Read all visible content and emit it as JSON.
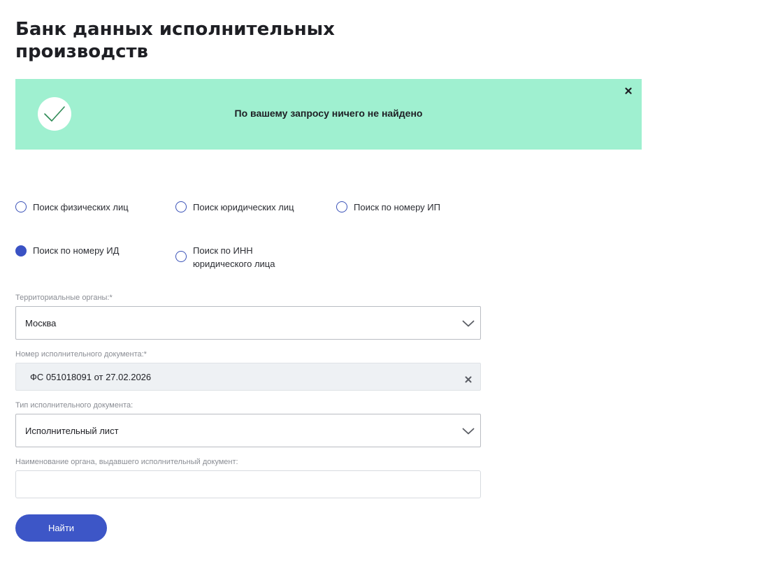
{
  "page": {
    "title": "Банк данных исполнительных производств"
  },
  "notification": {
    "message": "По вашему запросу ничего не найдено",
    "status_color": "#9ff0d0",
    "icon": "check-icon",
    "close_icon": "close-icon"
  },
  "search_types": {
    "selected": "Поиск по номеру ИД",
    "options": [
      {
        "label": "Поиск физических лиц",
        "checked": false
      },
      {
        "label": "Поиск юридических лиц",
        "checked": false
      },
      {
        "label": "Поиск по номеру ИП",
        "checked": false
      },
      {
        "label": "Поиск по номеру ИД",
        "checked": true
      },
      {
        "label": "Поиск по ИНН юридического лица",
        "checked": false
      }
    ]
  },
  "form": {
    "territorial_body": {
      "label": "Территориальные органы:*",
      "value": "Москва"
    },
    "document_number": {
      "label": "Номер исполнительного документа:*",
      "value": "ФС 051018091 от 27.02.2026"
    },
    "document_type": {
      "label": "Тип исполнительного документа:",
      "value": "Исполнительный лист"
    },
    "issuing_body": {
      "label": "Наименование органа, выдавшего исполнительный документ:",
      "value": ""
    },
    "submit_label": "Найти"
  },
  "colors": {
    "accent": "#3d56c7",
    "success_bg": "#9ff0d0"
  }
}
